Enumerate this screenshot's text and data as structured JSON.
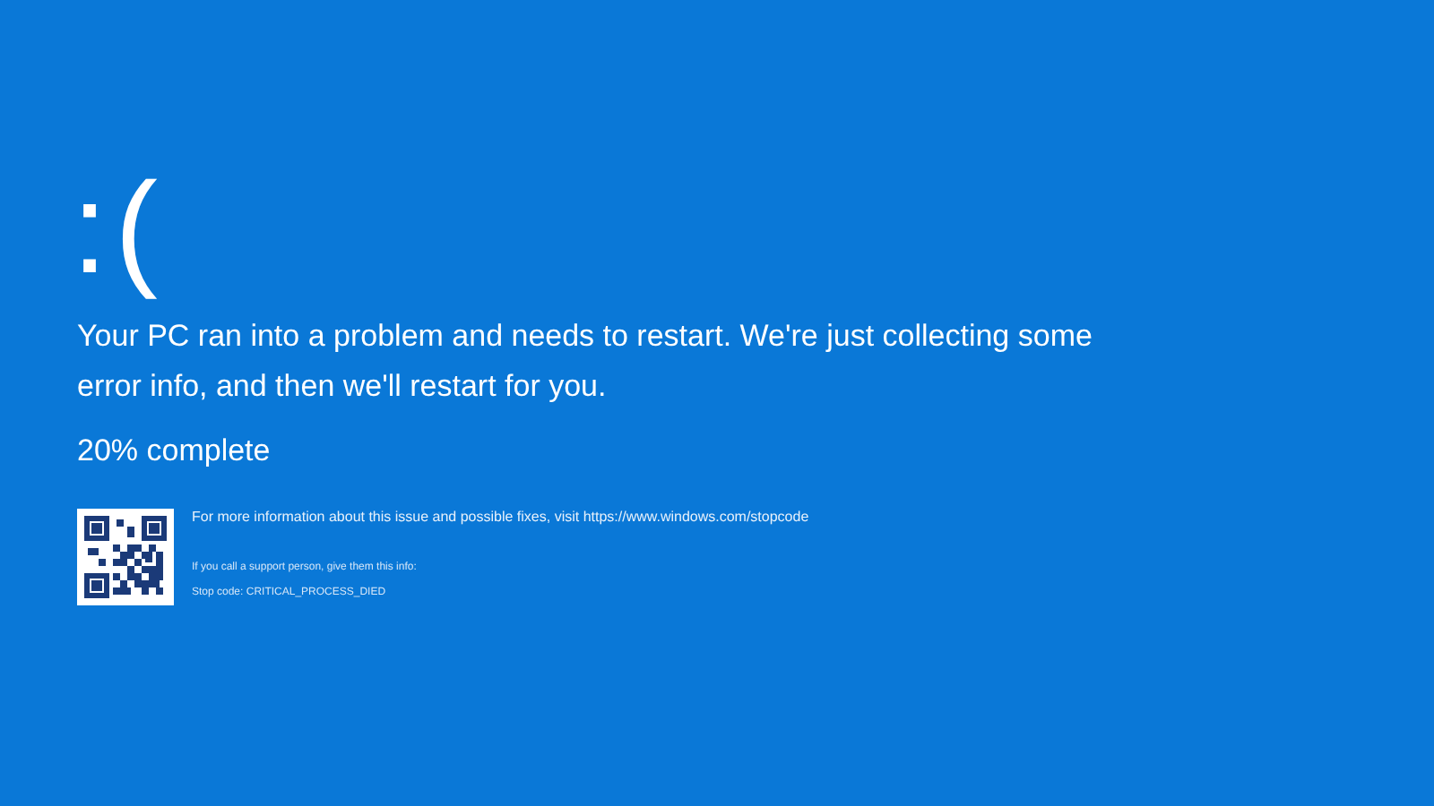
{
  "face": ":(",
  "message": "Your PC ran into a problem and needs to restart. We're just collecting some error info, and then we'll restart for you.",
  "progress": "20% complete",
  "details": {
    "info": "For more information about this issue and possible fixes, visit https://www.windows.com/stopcode",
    "support": "If you call a support person, give them this info:",
    "stop_code": "Stop code: CRITICAL_PROCESS_DIED"
  }
}
